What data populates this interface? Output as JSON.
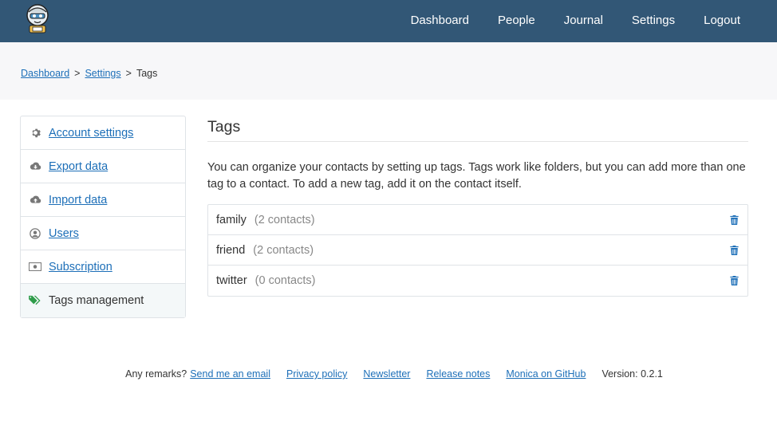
{
  "nav": {
    "items": [
      "Dashboard",
      "People",
      "Journal",
      "Settings",
      "Logout"
    ]
  },
  "breadcrumb": {
    "items": [
      "Dashboard",
      "Settings"
    ],
    "current": "Tags",
    "separator": ">"
  },
  "sidebar": {
    "items": [
      {
        "label": "Account settings",
        "icon": "gear-icon"
      },
      {
        "label": "Export data",
        "icon": "cloud-download-icon"
      },
      {
        "label": "Import data",
        "icon": "cloud-upload-icon"
      },
      {
        "label": "Users",
        "icon": "user-circle-icon"
      },
      {
        "label": "Subscription",
        "icon": "money-icon"
      },
      {
        "label": "Tags management",
        "icon": "tags-icon"
      }
    ]
  },
  "main": {
    "title": "Tags",
    "description": "You can organize your contacts by setting up tags. Tags work like folders, but you can add more than one tag to a contact. To add a new tag, add it on the contact itself.",
    "tags": [
      {
        "name": "family",
        "count": "(2 contacts)"
      },
      {
        "name": "friend",
        "count": "(2 contacts)"
      },
      {
        "name": "twitter",
        "count": "(0 contacts)"
      }
    ]
  },
  "footer": {
    "remarks": "Any remarks?",
    "email_link": "Send me an email",
    "links": [
      "Privacy policy",
      "Newsletter",
      "Release notes",
      "Monica on GitHub"
    ],
    "version": "Version: 0.2.1"
  },
  "colors": {
    "topbar": "#325776",
    "link": "#1d6fb8",
    "tag_icon": "#2e9c49",
    "muted": "#888888"
  }
}
